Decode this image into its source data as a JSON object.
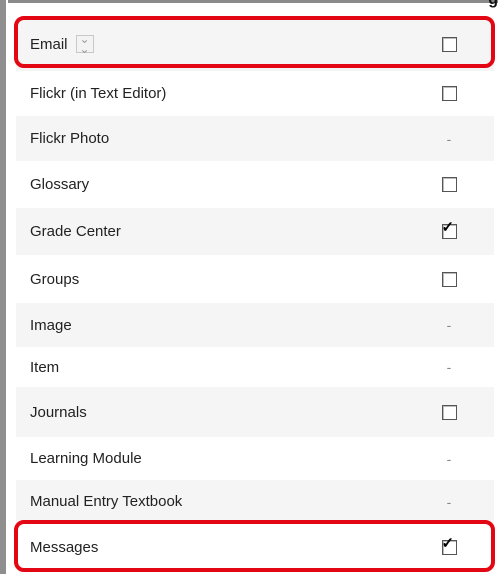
{
  "header_fragment": "g",
  "rows": [
    {
      "label": "Email",
      "has_menu": true,
      "cell": "checkbox",
      "checked": false
    },
    {
      "label": "Flickr (in Text Editor)",
      "cell": "checkbox",
      "checked": false
    },
    {
      "label": "Flickr Photo",
      "cell": "dash",
      "text": "-"
    },
    {
      "label": "Glossary",
      "cell": "checkbox",
      "checked": false
    },
    {
      "label": "Grade Center",
      "cell": "checkbox",
      "checked": true
    },
    {
      "label": "Groups",
      "cell": "checkbox",
      "checked": false
    },
    {
      "label": "Image",
      "cell": "dash",
      "text": "-"
    },
    {
      "label": "Item",
      "cell": "dash",
      "text": "-"
    },
    {
      "label": "Journals",
      "cell": "checkbox",
      "checked": false
    },
    {
      "label": "Learning Module",
      "cell": "dash",
      "text": "-"
    },
    {
      "label": "Manual Entry Textbook",
      "cell": "dash",
      "text": "-"
    },
    {
      "label": "Messages",
      "cell": "checkbox",
      "checked": true
    }
  ],
  "colors": {
    "highlight": "#e30613",
    "border": "#8f8f8f",
    "alt_row": "#f5f5f5"
  },
  "icons": {
    "menu": "double-chevron-down-icon",
    "check": "check-mark-icon"
  }
}
